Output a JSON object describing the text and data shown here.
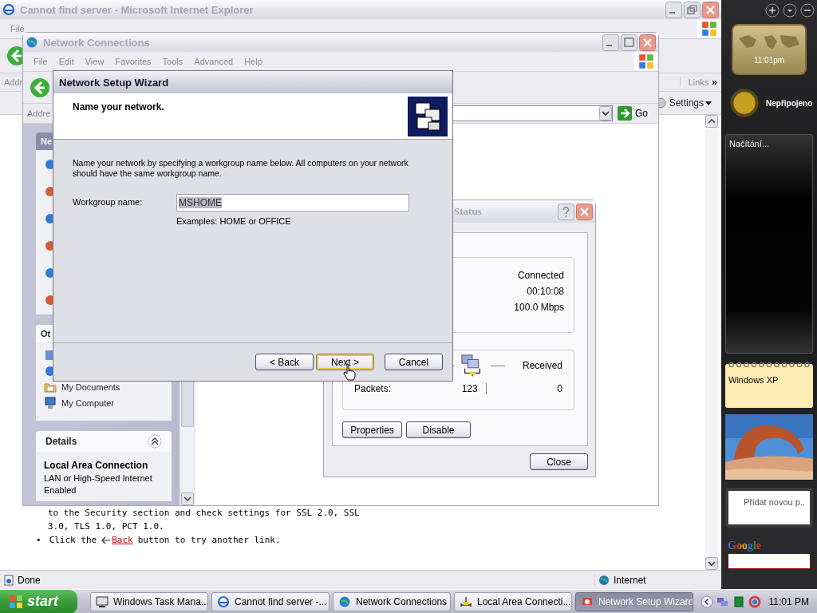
{
  "ie_window": {
    "title": "Cannot find server - Microsoft Internet Explorer",
    "active": false,
    "menu": [
      "File"
    ],
    "address_label": "Addr",
    "links_label": "Links",
    "links_more": "»",
    "settings_button": "Settings",
    "page_lines": [
      {
        "kind": "text",
        "text": "to the Security section and check settings for SSL 2.0, SSL"
      },
      {
        "kind": "text",
        "text": "3.0, TLS 1.0, PCT 1.0."
      },
      {
        "kind": "bullet",
        "bullet": "•",
        "before": "Click the",
        "link": "Back",
        "after": "button to try another link."
      }
    ],
    "status_text": "Done",
    "zone": "Internet"
  },
  "network_connections": {
    "title": "Network Connections",
    "active": false,
    "menu": [
      "File",
      "Edit",
      "View",
      "Favorites",
      "Tools",
      "Advanced",
      "Help"
    ],
    "address_label": "Addre",
    "go_button": "Go",
    "task_panes": [
      {
        "title": "Ne"
      },
      {
        "title": "Ot",
        "items": [
          {
            "label": "My Documents",
            "kind": "folder"
          },
          {
            "label": "My Computer",
            "kind": "computer"
          }
        ]
      }
    ],
    "details": {
      "title": "Details",
      "expanded": true,
      "name": "Local Area Connection",
      "lines": [
        "LAN or High-Speed Internet",
        "Enabled"
      ]
    }
  },
  "status_window": {
    "title": "Status",
    "active": false,
    "connection": [
      "Connected",
      "00:10:08",
      "100.0 Mbps"
    ],
    "activity_label": "Received",
    "packets_label": "Packets:",
    "sent": "123",
    "received": "0",
    "buttons": [
      "Properties",
      "Disable"
    ],
    "close_button": "Close"
  },
  "wizard": {
    "title": "Network Setup Wizard",
    "active": true,
    "heading": "Name your network.",
    "description": "Name your network by specifying a workgroup name below. All computers on your network should have the same workgroup name.",
    "field_label": "Workgroup name:",
    "field_value": "MSHOME",
    "value_highlighted": true,
    "hint": "Examples: HOME or OFFICE",
    "buttons": [
      {
        "label": "< Back",
        "default": false
      },
      {
        "label": "Next >",
        "default": true
      },
      {
        "label": "Cancel",
        "default": false
      }
    ]
  },
  "sidebar": {
    "clock": "11:01pm",
    "weather": "Nepřipojeno",
    "feed": "Načítání...",
    "note": "Windows XP",
    "add_note": "Přidat novou p..",
    "search_logo": "Google"
  },
  "taskbar": {
    "start": "start",
    "tasks": [
      {
        "label": "Windows Task Mana...",
        "kind": "monitor",
        "selected": false
      },
      {
        "label": "Cannot find server -...",
        "kind": "browser",
        "selected": false
      },
      {
        "label": "Network Connections",
        "kind": "globe",
        "selected": false
      },
      {
        "label": "Local Area Connecti...",
        "kind": "network",
        "selected": false
      },
      {
        "label": "Network Setup Wizard",
        "kind": "wizard",
        "selected": true
      }
    ],
    "clock": "11:01 PM"
  }
}
